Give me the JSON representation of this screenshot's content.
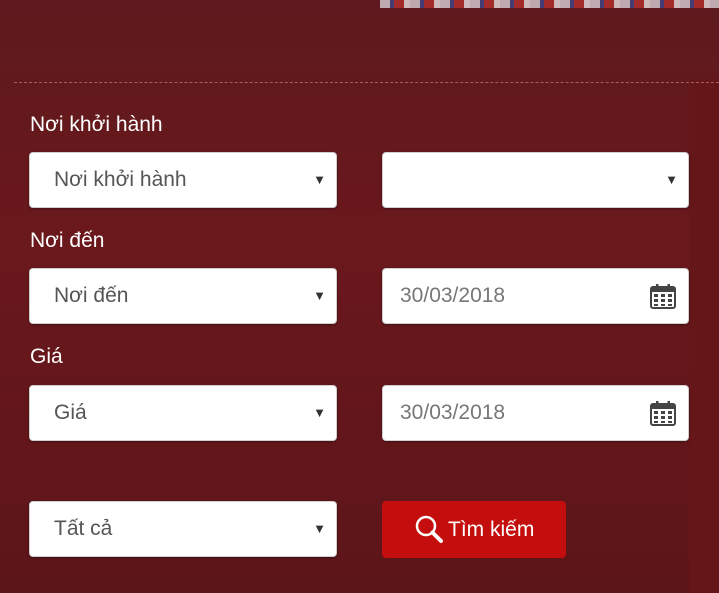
{
  "form": {
    "departure": {
      "label": "Nơi khởi hành",
      "select_value": "Nơi khởi hành",
      "secondary_value": ""
    },
    "destination": {
      "label": "Nơi đến",
      "select_value": "Nơi đến",
      "date_value": "30/03/2018"
    },
    "price": {
      "label": "Giá",
      "select_value": "Giá",
      "date_value": "30/03/2018"
    },
    "category": {
      "select_value": "Tất cả"
    },
    "search_button": {
      "label": "Tìm kiếm"
    }
  },
  "icons": {
    "dropdown": "chevron-down-icon",
    "date": "calendar-icon",
    "search": "search-icon"
  },
  "colors": {
    "background": "#6a181c",
    "button": "#c40d0d",
    "label_text": "#ffffff"
  }
}
